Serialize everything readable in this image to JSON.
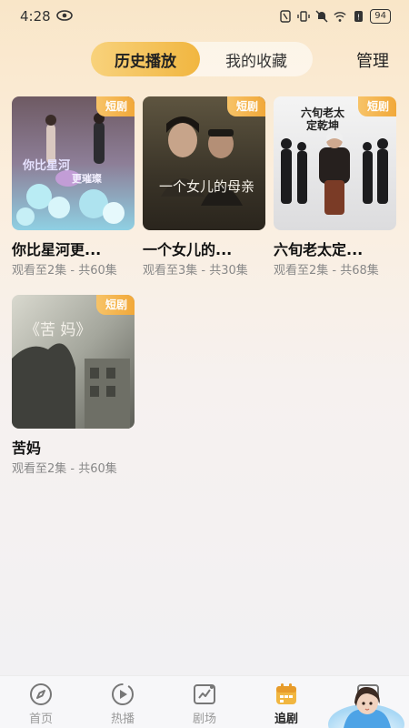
{
  "status_bar": {
    "time": "4:28",
    "battery": "94"
  },
  "header": {
    "tabs": [
      {
        "label": "历史播放",
        "active": true
      },
      {
        "label": "我的收藏",
        "active": false
      }
    ],
    "manage_label": "管理"
  },
  "cards": [
    {
      "title": "你比星河更...",
      "progress": "观看至2集 - 共60集",
      "badge": "短剧",
      "poster_text": "你比星河更璀璨"
    },
    {
      "title": "一个女儿的...",
      "progress": "观看至3集 - 共30集",
      "badge": "短剧",
      "poster_text": "一个女儿的母亲"
    },
    {
      "title": "六旬老太定...",
      "progress": "观看至2集 - 共68集",
      "badge": "短剧",
      "poster_text": "六旬老太定乾坤"
    },
    {
      "title": "苦妈",
      "progress": "观看至2集 - 共60集",
      "badge": "短剧",
      "poster_text": "《苦妈》"
    }
  ],
  "bottom_nav": [
    {
      "label": "首页",
      "icon": "compass-icon",
      "active": false
    },
    {
      "label": "热播",
      "icon": "play-circle-icon",
      "active": false
    },
    {
      "label": "剧场",
      "icon": "chart-icon",
      "active": false
    },
    {
      "label": "追剧",
      "icon": "calendar-icon",
      "active": true
    },
    {
      "label": "",
      "icon": "assistant-avatar-icon",
      "active": false
    }
  ],
  "colors": {
    "accent": "#f1b640",
    "badge": "#f1a839"
  }
}
